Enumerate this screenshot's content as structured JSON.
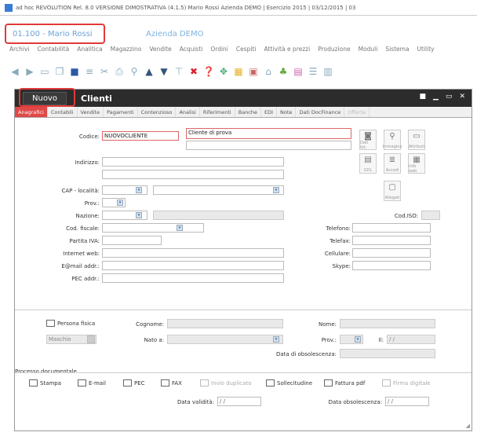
{
  "window_title": "ad hoc REVOLUTION Rel. 8.0 VERSIONE DIMOSTRATIVA (4.1.5) Mario Rossi Azienda DEMO | Esercizio 2015 | 03/12/2015 | 03",
  "user": "01.100 - Mario Rossi",
  "company": "Azienda DEMO",
  "menu": [
    "Archivi",
    "Contabilità",
    "Analitica",
    "Magazzino",
    "Vendite",
    "Acquisti",
    "Ordini",
    "Cespiti",
    "Attività e prezzi",
    "Produzione",
    "Moduli",
    "Sistema",
    "Utility"
  ],
  "toolbar_icons": [
    "back-icon",
    "forward-icon",
    "new-icon",
    "copy-icon",
    "save-icon",
    "list-icon",
    "cut-icon",
    "print-icon",
    "zoom-icon",
    "prev-record-icon",
    "next-record-icon",
    "filter-icon",
    "delete-icon",
    "help-icon",
    "pick-icon",
    "highlight-icon",
    "tools-icon",
    "home-icon",
    "scale-icon",
    "report-icon",
    "list2-icon",
    "grid-icon"
  ],
  "form": {
    "new_button": "Nuovo",
    "title": "Clienti",
    "tabs": [
      "Anagrafici",
      "Contabili",
      "Vendite",
      "Pagamenti",
      "Contenzioso",
      "Analisi",
      "Riferimenti",
      "Banche",
      "EDI",
      "Note",
      "Dati DocFinance",
      "Offerte"
    ],
    "fields": {
      "codice_label": "Codice:",
      "codice_value": "NUOVOCLIENTE",
      "descrizione_value": "Cliente di prova",
      "indirizzo_label": "Indirizzo:",
      "cap_label": "CAP - località:",
      "prov_label": "Prov.:",
      "nazione_label": "Nazione:",
      "codfisc_label": "Cod. fiscale:",
      "piva_label": "Partita IVA:",
      "internet_label": "Internet web:",
      "email_label": "E@mail addr.:",
      "pec_label": "PEC addr.:",
      "codiso_label": "Cod.ISO:",
      "telefono_label": "Telefono:",
      "telefax_label": "Telefax:",
      "cellulare_label": "Cellulare:",
      "skype_label": "Skype:"
    },
    "side_buttons": [
      "Dati fot.",
      "Immagine",
      "Attributi",
      "GDL",
      "Accedi",
      "Info web",
      "Allegati"
    ],
    "persona": {
      "checkbox_label": "Persona fisica",
      "sesso_value": "Maschio",
      "cognome_label": "Cognome:",
      "nome_label": "Nome:",
      "nato_label": "Nato a:",
      "prov_label": "Prov.:",
      "il_label": "Il:",
      "il_value": "/ /",
      "data_label": "Data di obsolescenza:"
    },
    "invio": {
      "section_label": "Processo documentale",
      "options": [
        "Stampa",
        "E-mail",
        "PEC",
        "FAX",
        "Invio duplicato",
        "Sollecitudine",
        "Fattura pdf",
        "Firma digitale"
      ],
      "data_validita_label": "Data validità:",
      "data_validita_value": "/ /",
      "data_obs_label": "Data obsolescenza:",
      "data_obs_value": "/ /"
    }
  }
}
